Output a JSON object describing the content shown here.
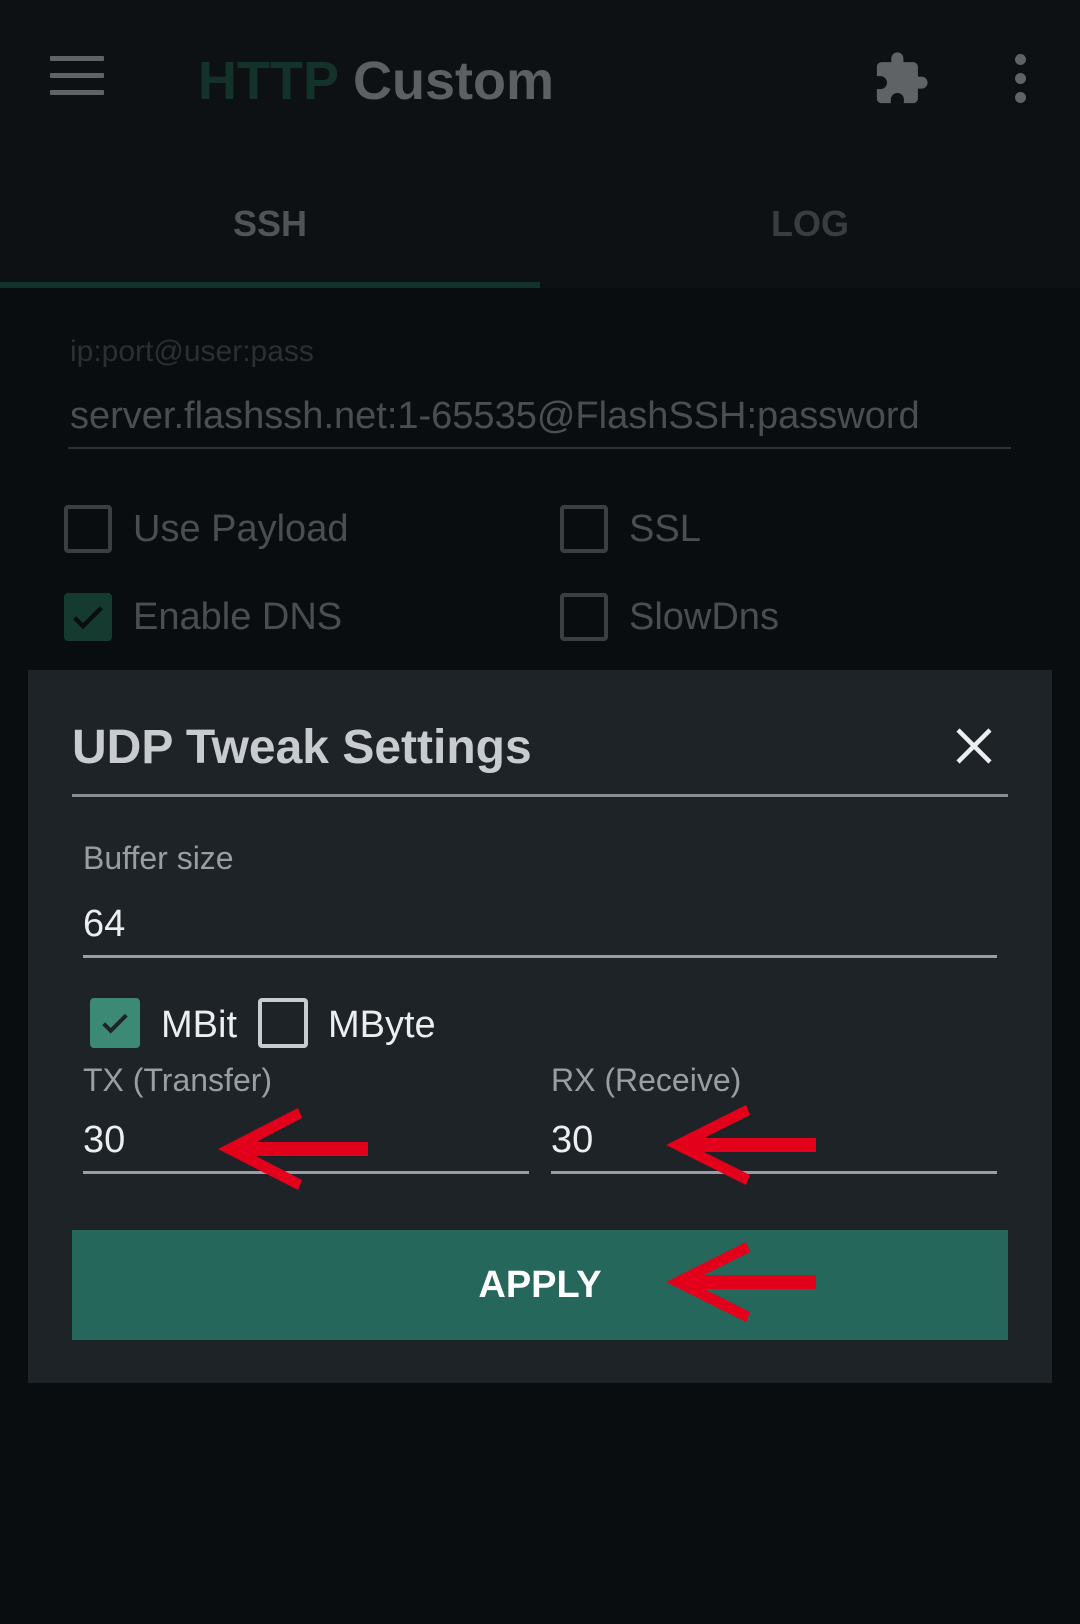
{
  "appbar": {
    "title_part1": "HTTP",
    "title_part2": "Custom",
    "menu_icon": "hamburger-menu-icon",
    "extension_icon": "puzzle-piece-icon",
    "overflow_icon": "three-dot-vertical-icon"
  },
  "tabs": [
    {
      "label": "SSH",
      "selected": true
    },
    {
      "label": "LOG",
      "selected": false
    }
  ],
  "config": {
    "hint": "ip:port@user:pass",
    "value": "server.flashssh.net:1-65535@FlashSSH:password"
  },
  "options": {
    "use_payload": {
      "label": "Use Payload",
      "checked": false
    },
    "ssl": {
      "label": "SSL",
      "checked": false
    },
    "enable_dns": {
      "label": "Enable DNS",
      "checked": true
    },
    "slowdns": {
      "label": "SlowDns",
      "checked": false
    }
  },
  "dialog": {
    "title": "UDP Tweak Settings",
    "close_icon": "close-x-icon",
    "buffer_size": {
      "label": "Buffer size",
      "value": "64"
    },
    "units": {
      "mbit": {
        "label": "MBit",
        "checked": true
      },
      "mbyte": {
        "label": "MByte",
        "checked": false
      }
    },
    "tx": {
      "label": "TX (Transfer)",
      "value": "30"
    },
    "rx": {
      "label": "RX (Receive)",
      "value": "30"
    },
    "apply_label": "APPLY"
  },
  "annotation_arrow_color": "#e2001a",
  "colors": {
    "accent": "#25675a",
    "checkbox_checked": "#3c8a76",
    "dialog_bg": "#1e2328",
    "screen_bg": "#0a0d10"
  }
}
